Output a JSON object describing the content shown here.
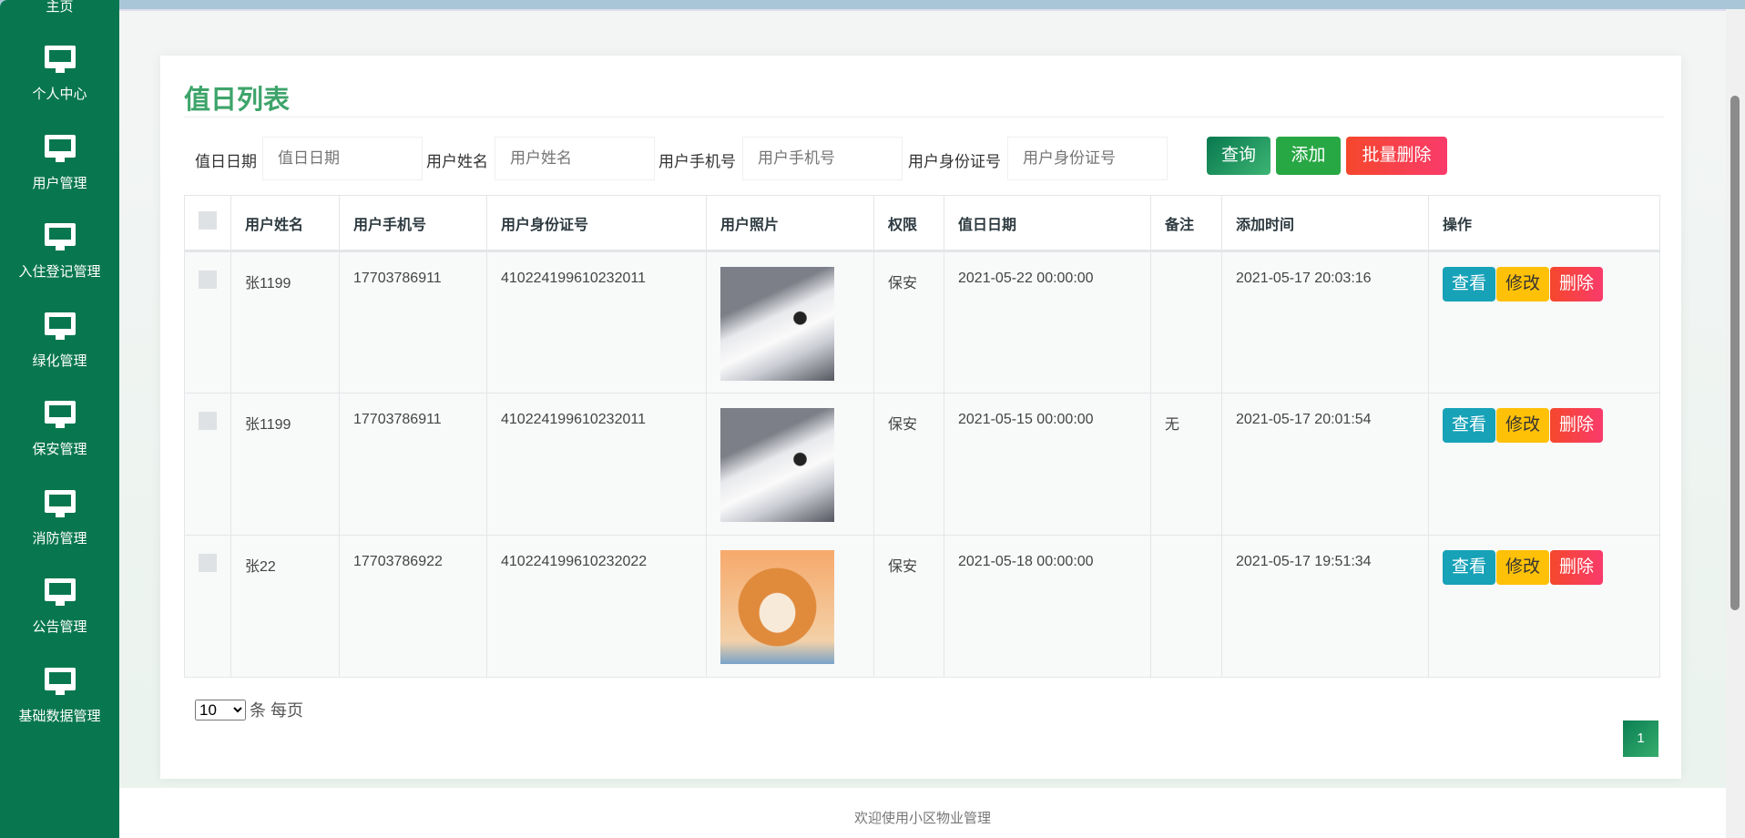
{
  "sidebar": {
    "items": [
      "主页",
      "个人中心",
      "用户管理",
      "入住登记管理",
      "绿化管理",
      "保安管理",
      "消防管理",
      "公告管理",
      "基础数据管理"
    ]
  },
  "page": {
    "title": "值日列表"
  },
  "filters": [
    {
      "label": "值日日期",
      "placeholder": "值日日期"
    },
    {
      "label": "用户姓名",
      "placeholder": "用户姓名"
    },
    {
      "label": "用户手机号",
      "placeholder": "用户手机号"
    },
    {
      "label": "用户身份证号",
      "placeholder": "用户身份证号"
    }
  ],
  "buttons": {
    "query": "查询",
    "add": "添加",
    "batch_delete": "批量删除"
  },
  "table": {
    "headers": [
      "用户姓名",
      "用户手机号",
      "用户身份证号",
      "用户照片",
      "权限",
      "值日日期",
      "备注",
      "添加时间",
      "操作"
    ],
    "rows": [
      {
        "name": "张1199",
        "phone": "17703786911",
        "id": "410224199610232011",
        "photo": "husky",
        "role": "保安",
        "date": "2021-05-22 00:00:00",
        "note": "",
        "added": "2021-05-17 20:03:16"
      },
      {
        "name": "张1199",
        "phone": "17703786911",
        "id": "410224199610232011",
        "photo": "husky",
        "role": "保安",
        "date": "2021-05-15 00:00:00",
        "note": "无",
        "added": "2021-05-17 20:01:54"
      },
      {
        "name": "张22",
        "phone": "17703786922",
        "id": "410224199610232022",
        "photo": "shiba",
        "role": "保安",
        "date": "2021-05-18 00:00:00",
        "note": "",
        "added": "2021-05-17 19:51:34"
      }
    ],
    "actions": {
      "view": "查看",
      "edit": "修改",
      "delete": "删除"
    }
  },
  "pagination": {
    "per_page": "10",
    "per_page_label": "条 每页",
    "current": "1"
  },
  "footer": "欢迎使用小区物业管理"
}
